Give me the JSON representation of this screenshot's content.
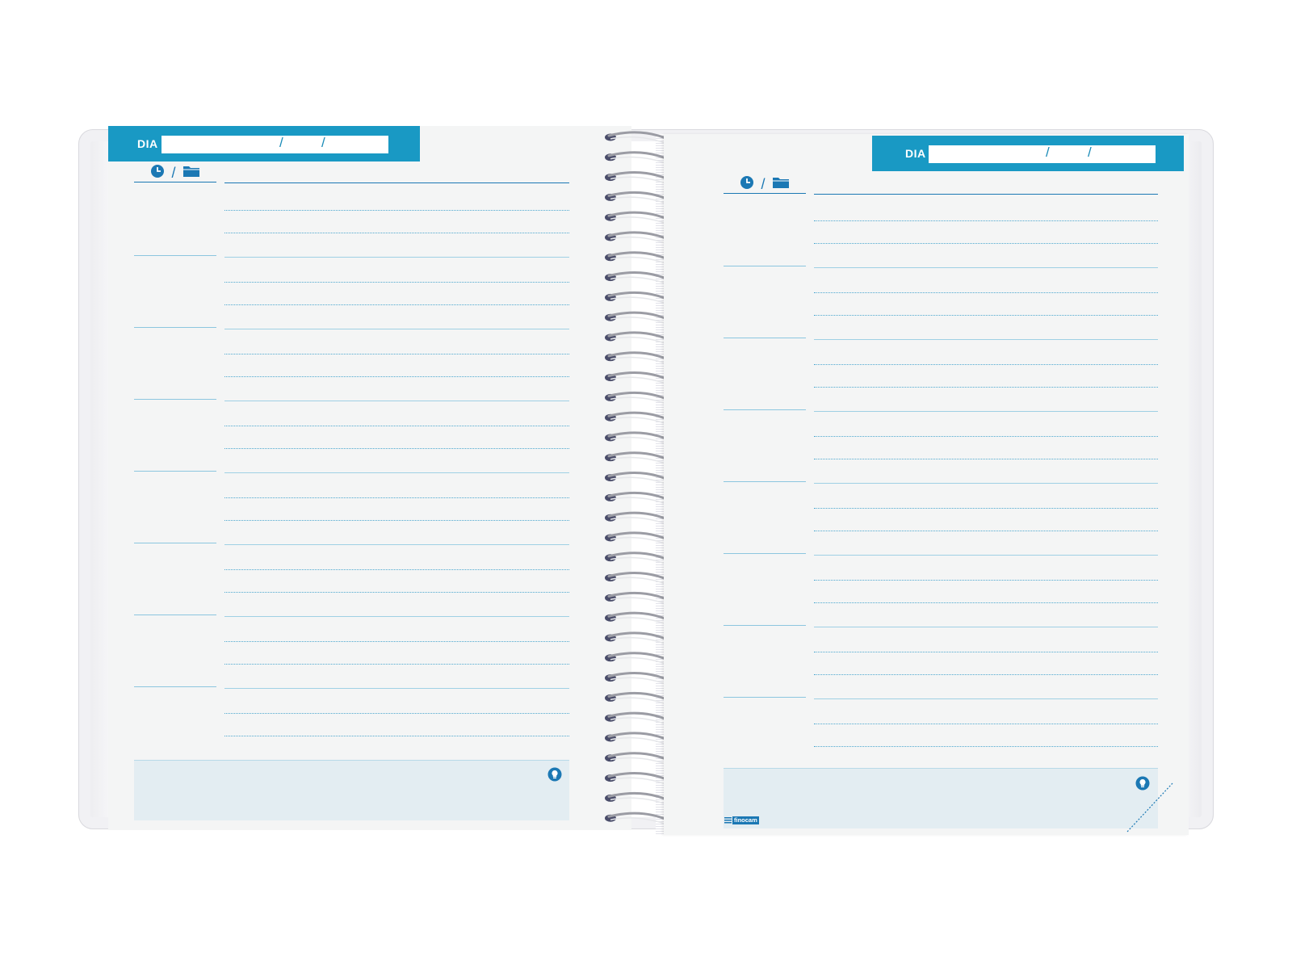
{
  "left_page": {
    "dia_label": "DIA",
    "date_separator": "/",
    "header_separator": "/"
  },
  "right_page": {
    "dia_label": "DIA",
    "date_separator": "/",
    "header_separator": "/"
  },
  "icons": {
    "time": "clock-icon",
    "subject": "folder-icon",
    "notes": "lightbulb-icon"
  },
  "brand": {
    "name": "finocam"
  },
  "colors": {
    "accent": "#1999c4",
    "rule": "#4ea8cf",
    "notes_bg": "#e3edf2",
    "page_bg": "#f4f5f5"
  }
}
